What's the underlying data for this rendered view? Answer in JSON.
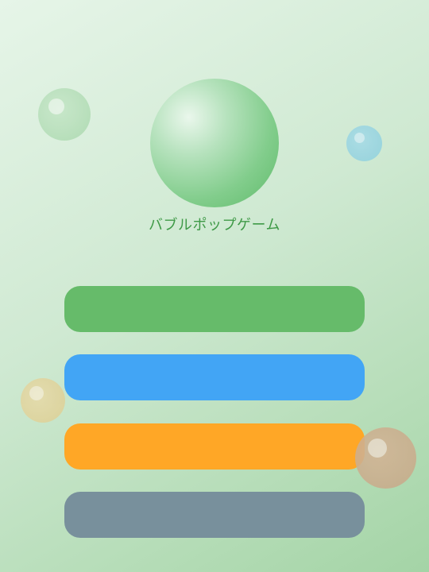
{
  "game": {
    "title": "バブルポップゲーム"
  },
  "menu": {
    "buttons": [
      {
        "color": "#66bb6a"
      },
      {
        "color": "#42a5f5"
      },
      {
        "color": "#ffa726"
      },
      {
        "color": "#78909c"
      }
    ]
  },
  "background": {
    "decorative_bubble_colors": [
      "#acdab0",
      "#8fd0dd",
      "#dccf94",
      "#c6a888"
    ]
  }
}
